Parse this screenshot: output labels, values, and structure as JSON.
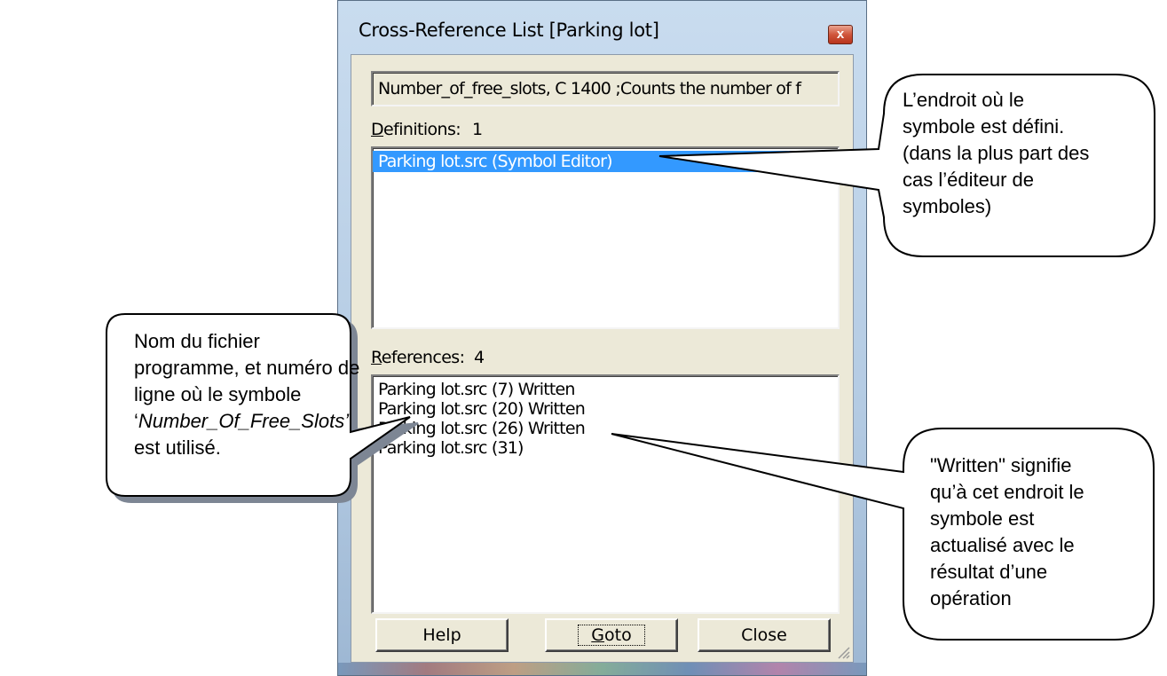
{
  "dialog": {
    "title": "Cross-Reference List [Parking lot]",
    "close_glyph": "x",
    "symbol_line": "Number_of_free_slots, C 1400 ;Counts the number of f",
    "definitions": {
      "label_accel": "D",
      "label_rest": "efinitions:",
      "count": "1",
      "items": [
        "Parking lot.src (Symbol Editor)"
      ]
    },
    "references": {
      "label_accel": "R",
      "label_rest": "eferences:",
      "count": "4",
      "items": [
        "Parking lot.src (7)  Written",
        "Parking lot.src (20)  Written",
        "Parking lot.src (26)  Written",
        "Parking lot.src (31)"
      ]
    },
    "buttons": {
      "help": "Help",
      "goto_accel": "G",
      "goto_rest": "oto",
      "close": "Close"
    }
  },
  "callouts": {
    "definition": [
      "L’endroit où le",
      "symbole est défini.",
      "(dans la plus part des",
      "cas l’éditeur de",
      "symboles)"
    ],
    "filename_line1": "Nom du fichier",
    "filename_line2": "programme, et numéro de",
    "filename_line3": "ligne où le symbole",
    "filename_quote_open": "‘",
    "filename_symbol": "Number_Of_Free_Slots’",
    "filename_line5": "est utilisé.",
    "written": [
      "\"Written\" signifie",
      "qu’à cet endroit le",
      "symbole est",
      "actualisé avec le",
      "résultat d’une",
      "opération"
    ]
  }
}
